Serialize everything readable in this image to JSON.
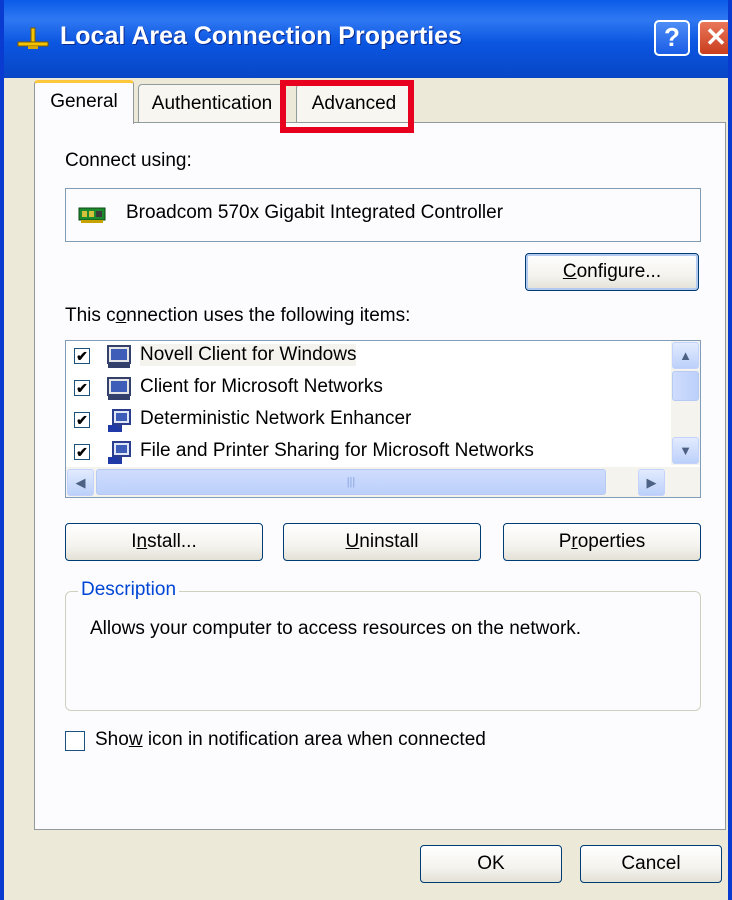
{
  "window": {
    "title": "Local Area Connection Properties",
    "help_label": "?",
    "close_label": "✕"
  },
  "tabs": [
    {
      "label": "General",
      "active": true
    },
    {
      "label": "Authentication",
      "active": false
    },
    {
      "label": "Advanced",
      "active": false
    }
  ],
  "general": {
    "connect_using_label": "Connect using:",
    "adapter_name": "Broadcom 570x Gigabit Integrated Controller",
    "configure_button": {
      "pre": "",
      "mnemonic": "C",
      "post": "onfigure..."
    },
    "items_label": {
      "pre": "This c",
      "mnemonic": "o",
      "post": "nnection uses the following items:"
    },
    "items": [
      {
        "label": "Novell Client for Windows",
        "checked": true,
        "selected": true
      },
      {
        "label": "Client for Microsoft Networks",
        "checked": true,
        "selected": false
      },
      {
        "label": "Deterministic Network Enhancer",
        "checked": true,
        "selected": false
      },
      {
        "label": "File and Printer Sharing for Microsoft Networks",
        "checked": true,
        "selected": false
      }
    ],
    "check_mark": "✔",
    "install_button": {
      "pre": "I",
      "mnemonic": "n",
      "post": "stall..."
    },
    "uninstall_button": {
      "pre": "",
      "mnemonic": "U",
      "post": "ninstall"
    },
    "properties_button": {
      "pre": "P",
      "mnemonic": "r",
      "post": "operties"
    },
    "description_title": "Description",
    "description_text": "Allows your computer to access resources on the network.",
    "notify_label": {
      "pre": "Sho",
      "mnemonic": "w",
      "post": " icon in notification area when connected"
    },
    "notify_checked": false
  },
  "footer": {
    "ok_label": "OK",
    "cancel_label": "Cancel"
  },
  "colors": {
    "title_bar": "#0a5be8",
    "highlight_box": "#e8001f",
    "description_title": "#0046d5"
  }
}
